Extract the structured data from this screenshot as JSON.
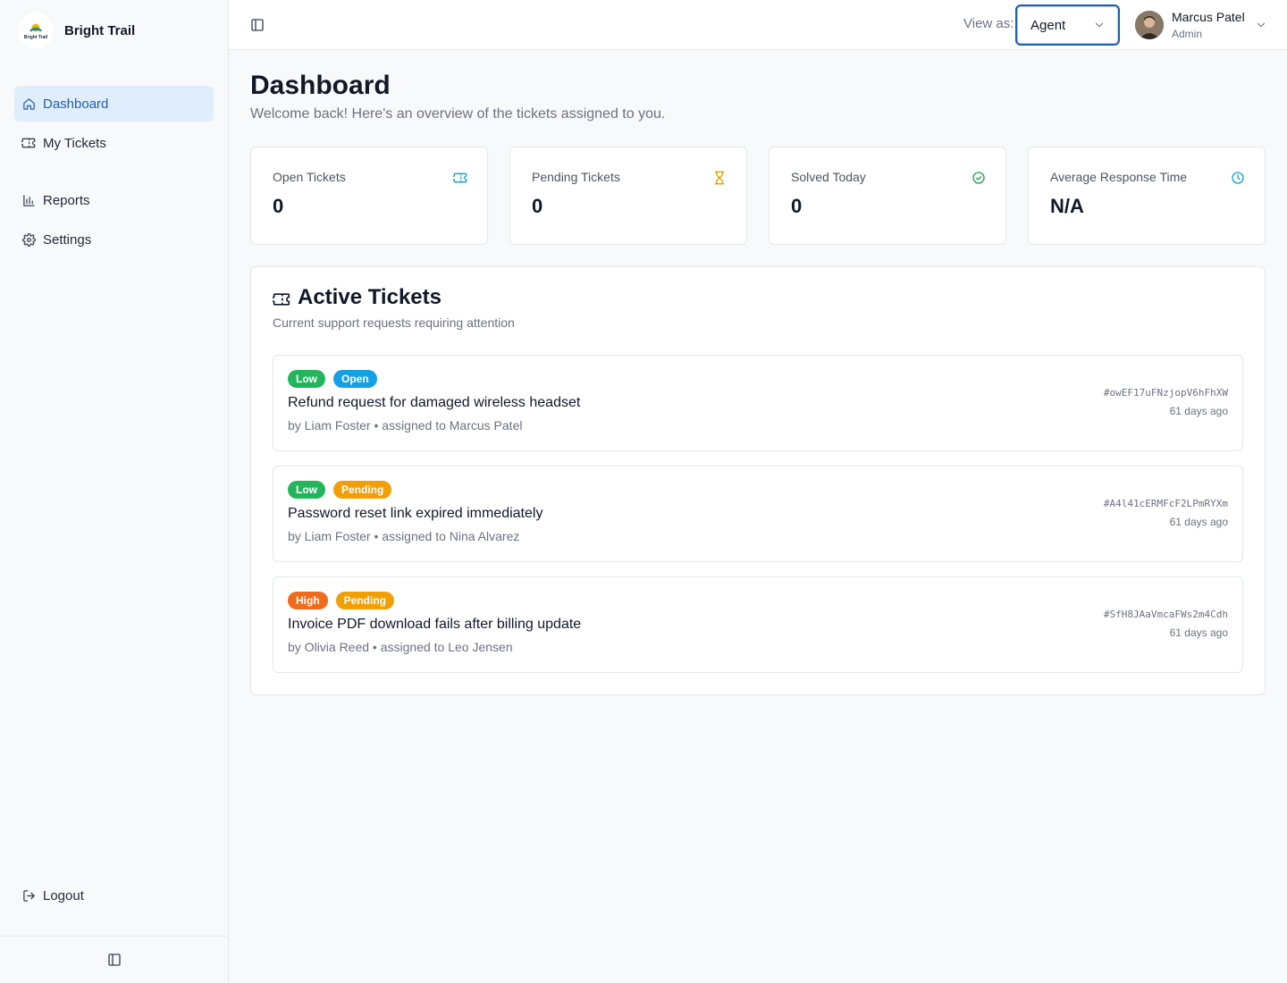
{
  "brand": {
    "name": "Bright Trail",
    "logo_text": "Bright Trail"
  },
  "sidebar": {
    "items": [
      {
        "label": "Dashboard",
        "icon": "home-icon",
        "active": true
      },
      {
        "label": "My Tickets",
        "icon": "ticket-icon",
        "active": false
      },
      {
        "label": "Reports",
        "icon": "bar-chart-icon",
        "active": false
      },
      {
        "label": "Settings",
        "icon": "gear-icon",
        "active": false
      }
    ],
    "logout_label": "Logout"
  },
  "header": {
    "view_as_label": "View as:",
    "view_as_value": "Agent",
    "user": {
      "name": "Marcus Patel",
      "role": "Admin"
    }
  },
  "page": {
    "title": "Dashboard",
    "subtitle": "Welcome back! Here's an overview of the tickets assigned to you."
  },
  "stats": [
    {
      "label": "Open Tickets",
      "value": "0",
      "icon": "ticket-icon",
      "color": "#0ea5c6"
    },
    {
      "label": "Pending Tickets",
      "value": "0",
      "icon": "hourglass-icon",
      "color": "#e0a100"
    },
    {
      "label": "Solved Today",
      "value": "0",
      "icon": "check-circle-icon",
      "color": "#16a34a"
    },
    {
      "label": "Average Response Time",
      "value": "N/A",
      "icon": "clock-icon",
      "color": "#0ea5c6"
    }
  ],
  "active_tickets": {
    "title": "Active Tickets",
    "description": "Current support requests requiring attention",
    "tickets": [
      {
        "priority": "Low",
        "status": "Open",
        "title": "Refund request for damaged wireless headset",
        "meta": "by Liam Foster • assigned to Marcus Patel",
        "id": "#owEF17uFNzjopV6hFhXW",
        "age": "61 days ago"
      },
      {
        "priority": "Low",
        "status": "Pending",
        "title": "Password reset link expired immediately",
        "meta": "by Liam Foster • assigned to Nina Alvarez",
        "id": "#A4l41cERMFcF2LPmRYXm",
        "age": "61 days ago"
      },
      {
        "priority": "High",
        "status": "Pending",
        "title": "Invoice PDF download fails after billing update",
        "meta": "by Olivia Reed • assigned to Leo Jensen",
        "id": "#SfH8JAaVmcaFWs2m4Cdh",
        "age": "61 days ago"
      }
    ]
  },
  "colors": {
    "accent": "#1f5fb0",
    "badge_low": "#22b55b",
    "badge_high": "#f26b1d",
    "badge_open": "#14a0e6",
    "badge_pending": "#f29f05"
  }
}
